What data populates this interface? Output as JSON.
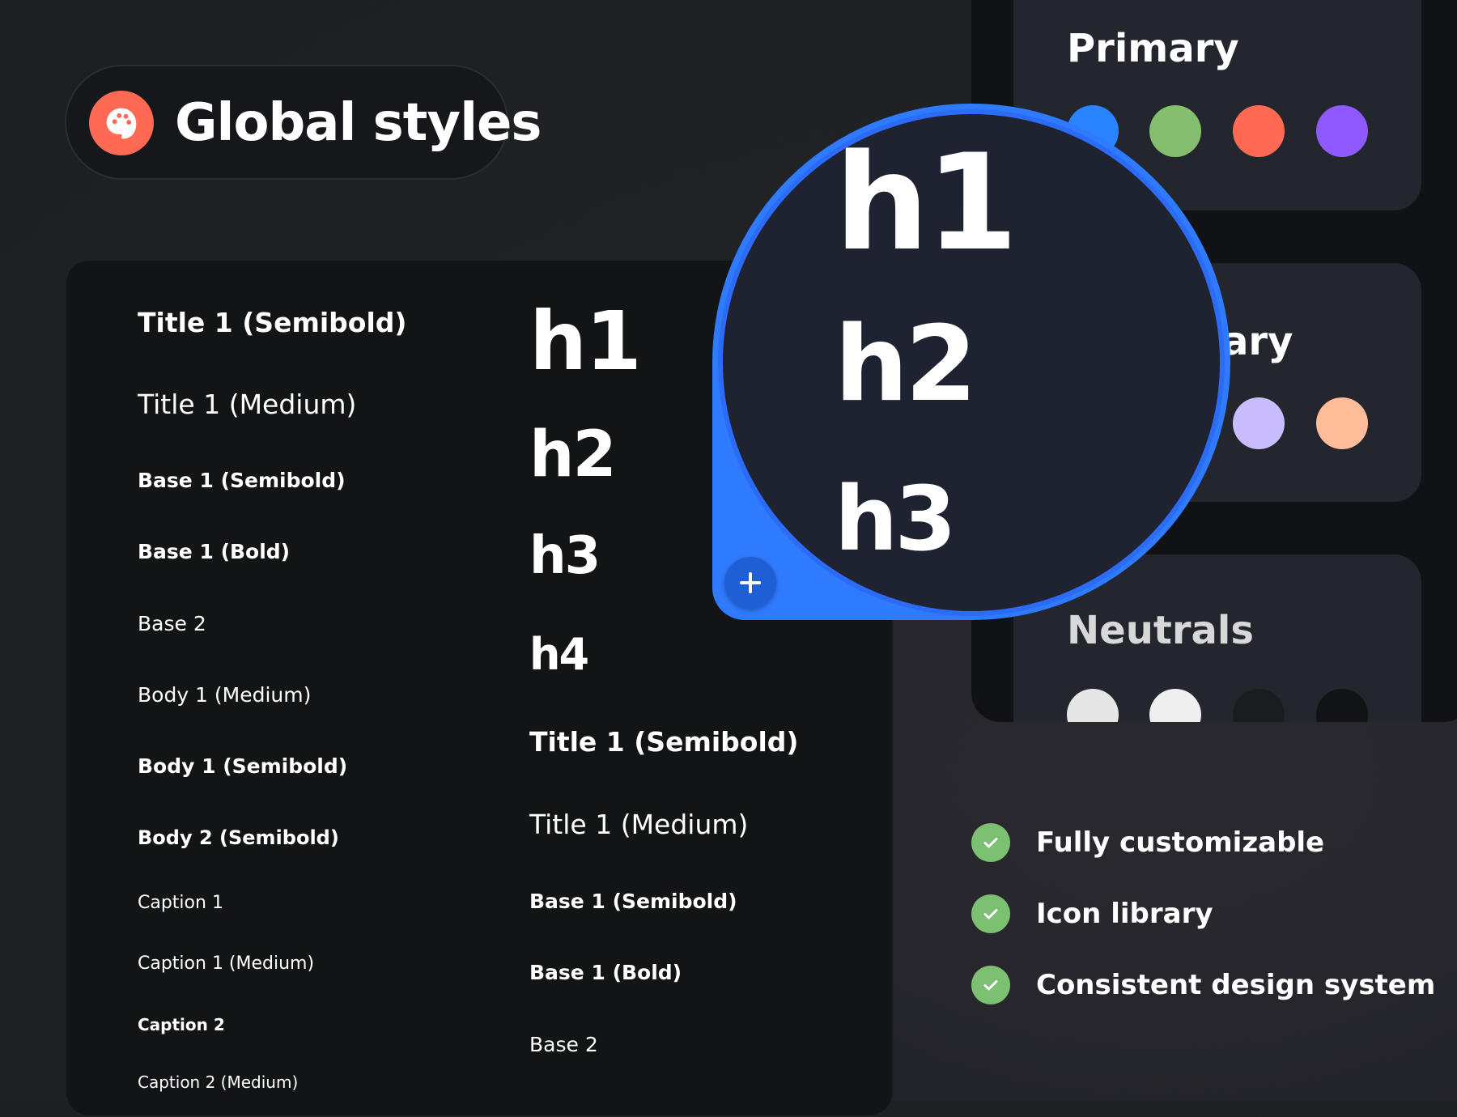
{
  "header": {
    "title": "Global styles",
    "icon": "palette-icon",
    "icon_color": "#ff6a55"
  },
  "typography": {
    "left_column": [
      "Title 1 (Semibold)",
      "Title 1 (Medium)",
      "Base 1 (Semibold)",
      "Base 1 (Bold)",
      "Base 2",
      "Body 1 (Medium)",
      "Body 1 (Semibold)",
      "Body 2 (Semibold)",
      "Caption 1",
      "Caption 1 (Medium)",
      "Caption 2",
      "Caption 2 (Medium)"
    ],
    "headings": [
      "h1",
      "h2",
      "h3",
      "h4"
    ],
    "right_column": [
      "Title 1 (Semibold)",
      "Title 1 (Medium)",
      "Base 1 (Semibold)",
      "Base 1 (Bold)",
      "Base 2"
    ]
  },
  "magnifier": {
    "headings": [
      "h1",
      "h2",
      "h3"
    ],
    "add_icon": "plus-icon",
    "ring_color": "#2f7bff"
  },
  "colors": {
    "primary": {
      "title": "Primary",
      "swatches": [
        "#2a84ff",
        "#83bf6e",
        "#ff6a55",
        "#8e59ff"
      ]
    },
    "secondary": {
      "title": "ary",
      "swatches": [
        "#cabdff",
        "#ffbc99"
      ]
    },
    "neutrals": {
      "title": "Neutrals",
      "swatches": [
        "#e6e6e6",
        "#efefef",
        "#1a1d1f",
        "#111315"
      ]
    }
  },
  "features": [
    {
      "label": "Fully customizable",
      "icon": "check-icon"
    },
    {
      "label": "Icon library",
      "icon": "check-icon"
    },
    {
      "label": "Consistent design system",
      "icon": "check-icon"
    }
  ],
  "accent_check_color": "#7cc072"
}
